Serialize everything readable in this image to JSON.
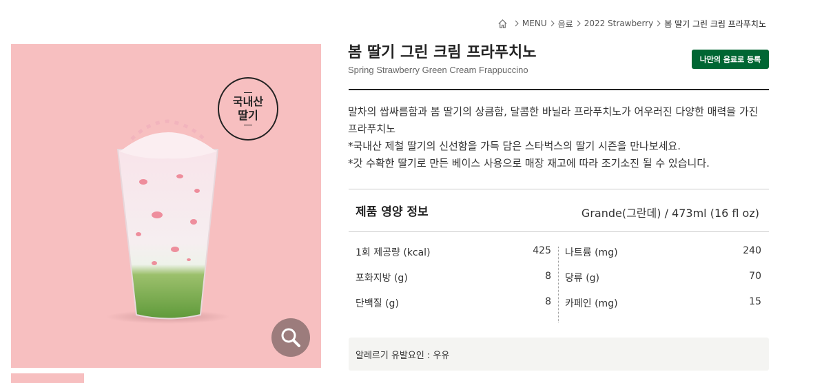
{
  "breadcrumb": {
    "items": [
      "MENU",
      "음료",
      "2022 Strawberry",
      "봄 딸기 그린 크림 프라푸치노"
    ]
  },
  "product": {
    "name_ko": "봄 딸기 그린 크림 프라푸치노",
    "name_en": "Spring Strawberry Green Cream Frappuccino",
    "badge": [
      "국내산",
      "딸기"
    ],
    "favorite_button": "나만의 음료로 등록",
    "description": [
      "말차의 쌉싸름함과 봄 딸기의 상큼함, 달콤한 바닐라 프라푸치노가 어우러진 다양한 매력을 가진 프라푸치노",
      "*국내산 제철 딸기의 신선함을 가득 담은 스타벅스의 딸기 시즌을 만나보세요.",
      "*갓 수확한 딸기로 만든 베이스 사용으로 매장 재고에 따라 조기소진 될 수 있습니다."
    ],
    "image_bg": "#f7bfc0"
  },
  "nutrition": {
    "title": "제품 영양 정보",
    "size": "Grande(그란데) / 473ml (16 fl oz)",
    "left": [
      {
        "label": "1회 제공량 (kcal)",
        "value": "425"
      },
      {
        "label": "포화지방 (g)",
        "value": "8"
      },
      {
        "label": "단백질 (g)",
        "value": "8"
      }
    ],
    "right": [
      {
        "label": "나트륨 (mg)",
        "value": "240"
      },
      {
        "label": "당류 (g)",
        "value": "70"
      },
      {
        "label": "카페인 (mg)",
        "value": "15"
      }
    ]
  },
  "allergy": "알레르기 유발요인 : 우유",
  "colors": {
    "brand_green": "#006633",
    "image_background": "#f7bfc0"
  }
}
